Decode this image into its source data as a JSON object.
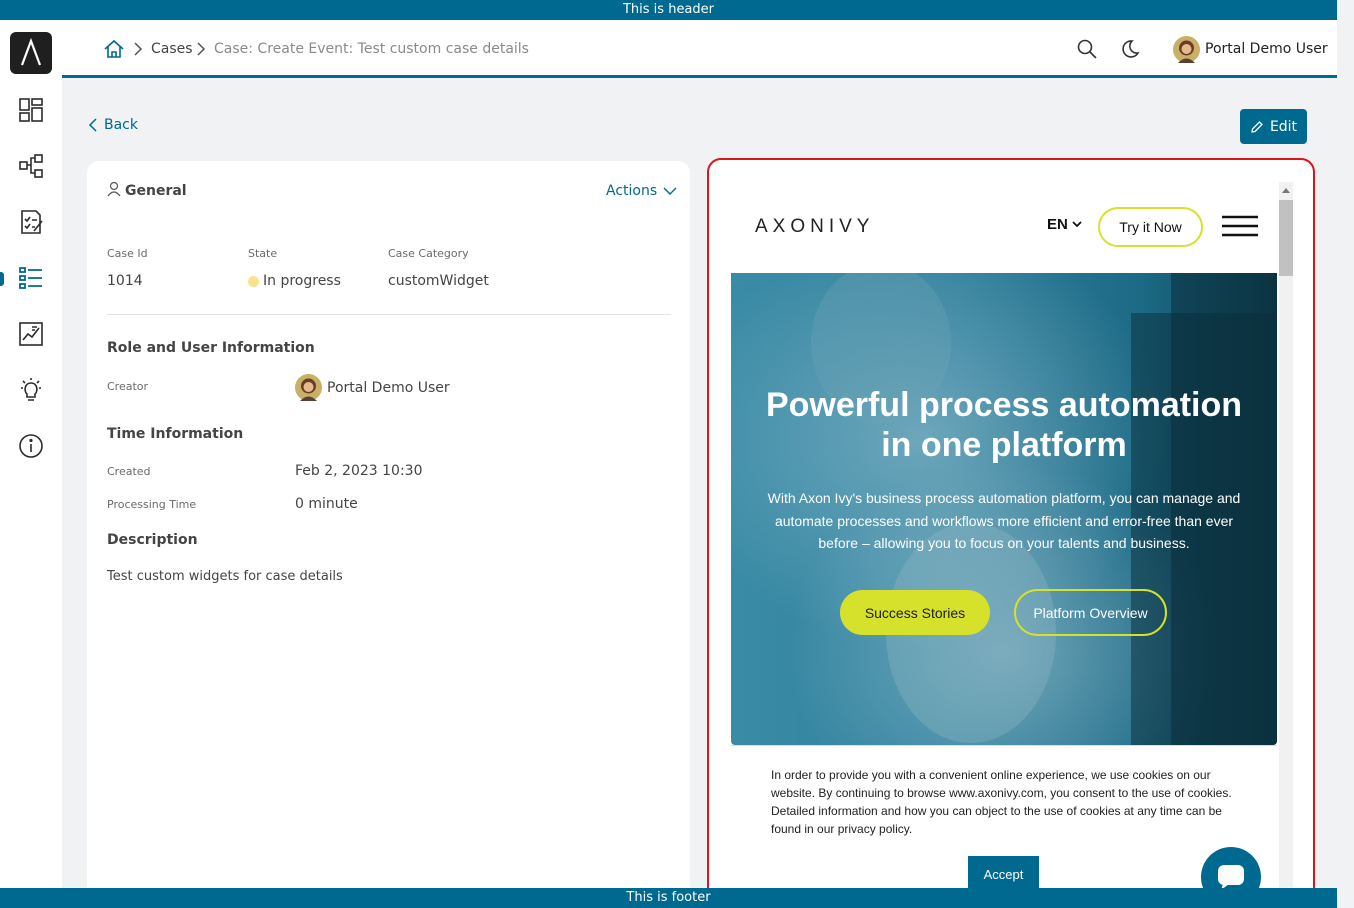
{
  "banners": {
    "header": "This is header",
    "footer": "This is footer"
  },
  "sidebar": {
    "logo": "axon-ivy-logo",
    "items": [
      {
        "name": "dashboard",
        "icon": "dashboard-icon"
      },
      {
        "name": "processes",
        "icon": "process-tree-icon"
      },
      {
        "name": "tasks",
        "icon": "task-list-icon"
      },
      {
        "name": "cases",
        "icon": "case-list-icon",
        "active": true
      },
      {
        "name": "statistics",
        "icon": "statistics-icon"
      },
      {
        "name": "ideas",
        "icon": "lightbulb-icon"
      },
      {
        "name": "about",
        "icon": "info-icon"
      }
    ]
  },
  "breadcrumb": {
    "home_icon": "home-icon",
    "cases": "Cases",
    "current": "Case: Create Event: Test custom case details"
  },
  "topbar": {
    "search_icon": "search-icon",
    "theme_icon": "moon-icon",
    "user_name": "Portal Demo User"
  },
  "actions_bar": {
    "back_label": "Back",
    "edit_label": "Edit"
  },
  "case_details": {
    "general_title": "General",
    "actions_label": "Actions",
    "case_id_label": "Case Id",
    "case_id": "1014",
    "state_label": "State",
    "state": "In progress",
    "state_color": "#f8e38a",
    "category_label": "Case Category",
    "category": "customWidget",
    "role_title": "Role and User Information",
    "creator_label": "Creator",
    "creator": "Portal Demo User",
    "time_title": "Time Information",
    "created_label": "Created",
    "created": "Feb 2, 2023 10:30",
    "processing_label": "Processing Time",
    "processing": "0 minute",
    "description_title": "Description",
    "description": "Test custom widgets for case details"
  },
  "website": {
    "logo_text": "AXONIVY",
    "language": "EN",
    "try_button": "Try it Now",
    "hero_title_line1": "Powerful process automation",
    "hero_title_line2": "in one platform",
    "hero_line1": "With Axon Ivy's business process automation platform, you can manage and",
    "hero_line2": "automate processes and workflows more efficient and error-free than ever",
    "hero_line3": "before – allowing you to focus on your talents and business.",
    "btn_success": "Success Stories",
    "btn_platform": "Platform Overview",
    "cookie_text": "In order to provide you with a convenient online experience, we use cookies on our website. By continuing to browse www.axonivy.com, you consent to the use of cookies. Detailed information and how you can object to the use of cookies at any time can be found in our privacy policy.",
    "accept": "Accept",
    "accent_color": "#d6e12b",
    "brand_color": "#00698f"
  }
}
